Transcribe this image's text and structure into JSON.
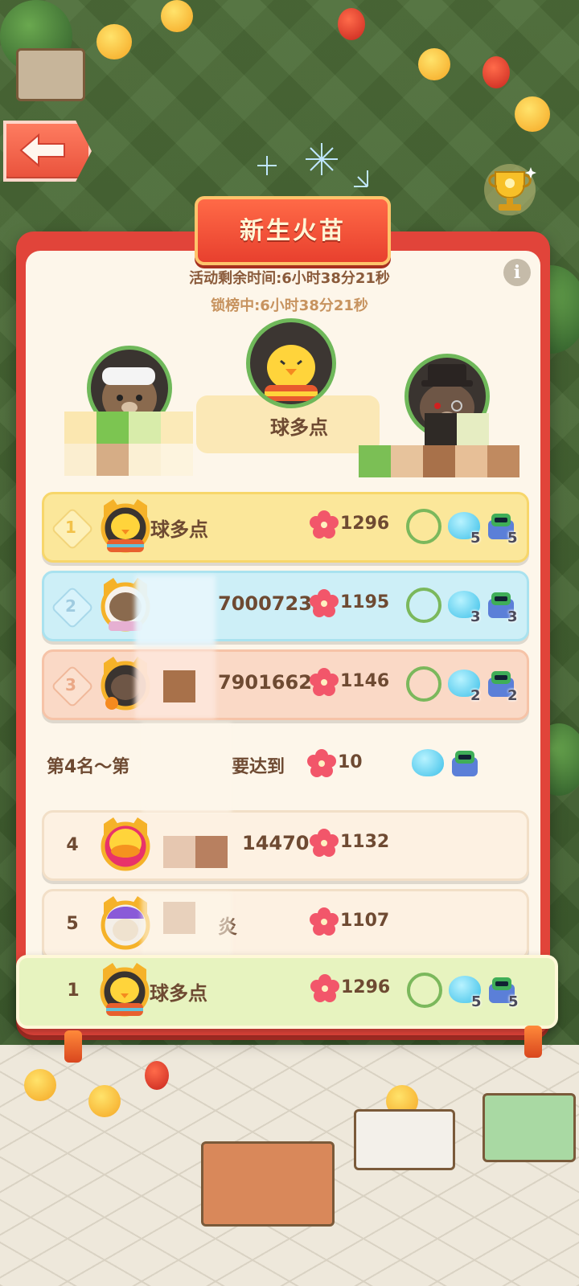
{
  "event": {
    "title": "新生火苗",
    "time_remaining": "活动剩余时间:6小时38分21秒",
    "lock_time": "锁榜中:6小时38分21秒"
  },
  "podium": {
    "first_name": "球多点"
  },
  "leaderboard": [
    {
      "rank": "1",
      "name": "球多点",
      "score": "1296",
      "slime_count": "5",
      "robot_count": "5",
      "style": "gold"
    },
    {
      "rank": "2",
      "name": "70007233",
      "score": "1195",
      "slime_count": "3",
      "robot_count": "3",
      "style": "blue"
    },
    {
      "rank": "3",
      "name": "79016620",
      "score": "1146",
      "slime_count": "2",
      "robot_count": "2",
      "style": "peach"
    }
  ],
  "threshold": {
    "prefix": "第4名～第",
    "suffix": "要达到",
    "value": "10"
  },
  "others": [
    {
      "rank": "4",
      "name": "14470",
      "score": "1132"
    },
    {
      "rank": "5",
      "name": "炎",
      "score": "1107"
    }
  ],
  "self_row": {
    "rank": "1",
    "name": "球多点",
    "score": "1296",
    "slime_count": "5",
    "robot_count": "5"
  },
  "icons": {
    "back": "arrow-left-icon",
    "trophy": "trophy-icon",
    "info": "info-icon",
    "currency": "flower-icon",
    "reward_frame": "vine-ring-icon",
    "reward_slime": "blue-slime-icon",
    "reward_robot": "robot-cat-icon"
  },
  "colors": {
    "panel_red": "#e1443a",
    "panel_cream": "#fdf6ea",
    "gold_row": "#fbe79a",
    "blue_row": "#cdeff7",
    "peach_row": "#fad9c6",
    "self_row": "#e7f3bf",
    "text_brown": "#6e4a32"
  }
}
